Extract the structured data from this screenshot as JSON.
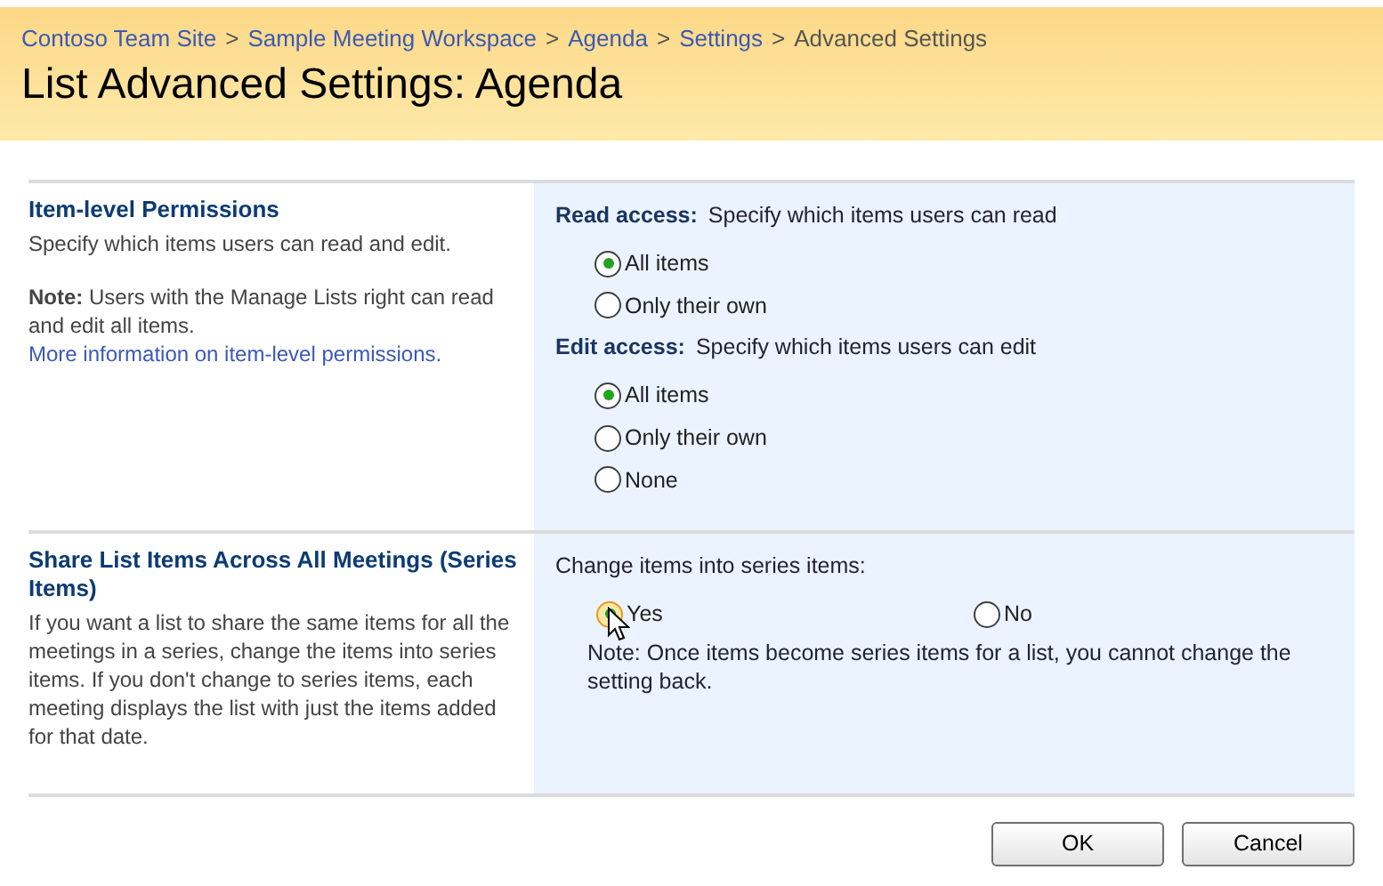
{
  "breadcrumb": [
    {
      "kind": "link",
      "label": "Contoso Team Site"
    },
    {
      "kind": "separator",
      "label": ">"
    },
    {
      "kind": "link",
      "label": "Sample Meeting Workspace"
    },
    {
      "kind": "separator",
      "label": ">"
    },
    {
      "kind": "link",
      "label": "Agenda"
    },
    {
      "kind": "separator",
      "label": ">"
    },
    {
      "kind": "link",
      "label": "Settings"
    },
    {
      "kind": "separator",
      "label": ">"
    },
    {
      "kind": "current",
      "label": "Advanced Settings"
    }
  ],
  "page_title": "List Advanced Settings: Agenda",
  "sections": [
    {
      "title": "Item-level Permissions",
      "description": [
        "Specify which items users can read and edit.",
        "**Note:** Users with the Manage Lists right can read and edit all items."
      ],
      "link": "More information on item-level permissions.",
      "groups": [
        {
          "label": "Read access:",
          "hint": "Specify which items users can read",
          "kind": "vertical",
          "options": [
            {
              "label": "All items",
              "selected": true
            },
            {
              "label": "Only their own",
              "selected": false
            }
          ]
        },
        {
          "label": "Edit access:",
          "hint": "Specify which items users can edit",
          "kind": "vertical",
          "options": [
            {
              "label": "All items",
              "selected": true
            },
            {
              "label": "Only their own",
              "selected": false
            },
            {
              "label": "None",
              "selected": false
            }
          ]
        }
      ]
    },
    {
      "title": "Share List Items Across All Meetings (Series Items)",
      "description": [
        "If you want a list to share the same items for all the meetings in a series, change the items into series items.  If you don't change to series items, each meeting displays the list with just the items added for that date."
      ],
      "groups": [
        {
          "hint": "Change items into series items:",
          "kind": "horizontal",
          "options": [
            {
              "label": "Yes",
              "selected": true,
              "hovered": true
            },
            {
              "label": "No",
              "selected": false
            }
          ],
          "note": "Note: Once items become series items for a list, you cannot change the setting back."
        }
      ]
    }
  ],
  "buttons": [
    "OK",
    "Cancel"
  ]
}
